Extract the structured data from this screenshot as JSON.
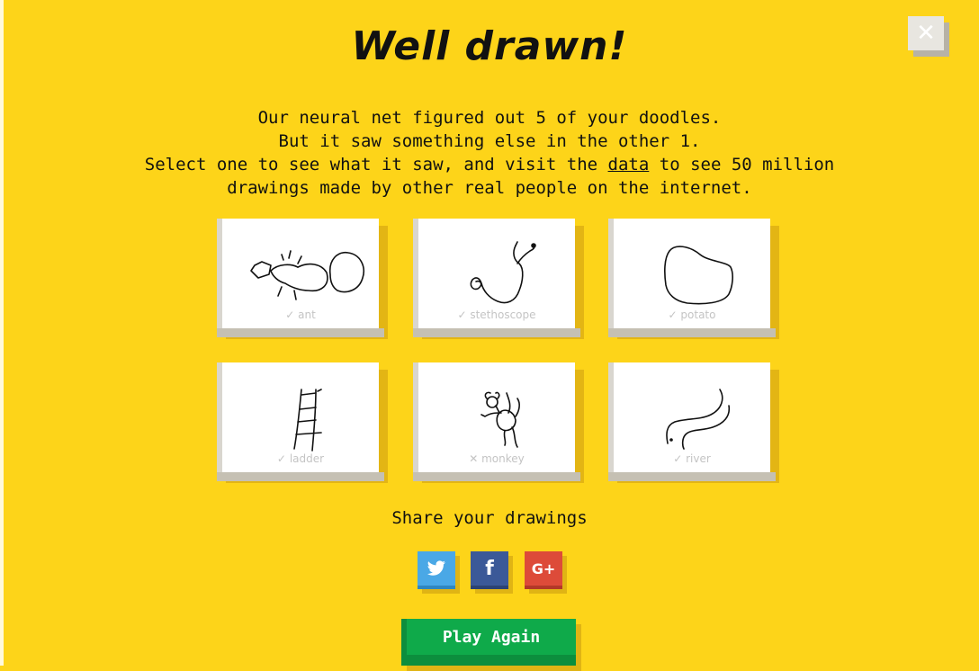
{
  "header": {
    "title": "Well drawn!",
    "close_icon": "close-icon",
    "close_glyph": "✕"
  },
  "message": {
    "line1": "Our neural net figured out 5 of your doodles.",
    "line2": "But it saw something else in the other 1.",
    "line3_before": "Select one to see what it saw, and visit the ",
    "line3_link": "data",
    "line3_after": " to see 50 million",
    "line4": "drawings made by other real people on the internet."
  },
  "doodles": [
    {
      "label": "ant",
      "status": "✓",
      "recognized": true
    },
    {
      "label": "stethoscope",
      "status": "✓",
      "recognized": true
    },
    {
      "label": "potato",
      "status": "✓",
      "recognized": true
    },
    {
      "label": "ladder",
      "status": "✓",
      "recognized": true
    },
    {
      "label": "monkey",
      "status": "✕",
      "recognized": false
    },
    {
      "label": "river",
      "status": "✓",
      "recognized": true
    }
  ],
  "share": {
    "title": "Share your drawings",
    "twitter_icon": "twitter-icon",
    "facebook_icon": "facebook-icon",
    "googleplus_icon": "google-plus-icon",
    "twitter_glyph": "🐦",
    "facebook_glyph": "f",
    "googleplus_glyph": "G+"
  },
  "play_again": {
    "label": "Play Again"
  },
  "colors": {
    "background": "#fdd419",
    "twitter": "#4aa8e6",
    "facebook": "#3b5998",
    "googleplus": "#dd4b39",
    "play": "#0faa4a"
  }
}
